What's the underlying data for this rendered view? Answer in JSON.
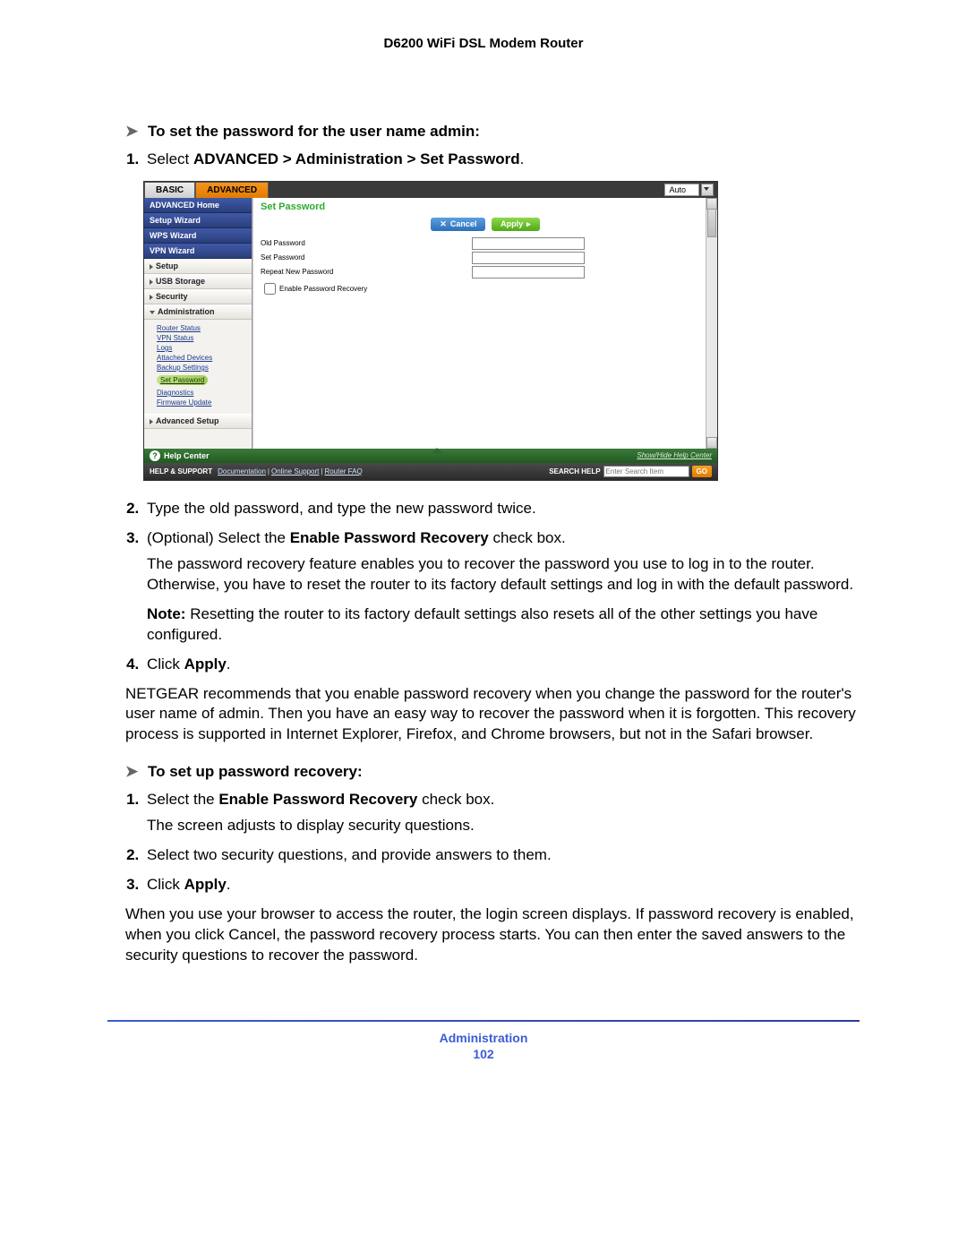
{
  "header": {
    "title": "D6200 WiFi DSL Modem Router"
  },
  "task1": {
    "heading": "To set the password for the user name admin:",
    "steps": {
      "s1_pre": "Select ",
      "s1_bold": "ADVANCED > Administration > Set Password",
      "s1_post": ".",
      "s2": "Type the old password, and type the new password twice.",
      "s3_pre": "(Optional) Select the ",
      "s3_bold": "Enable Password Recovery",
      "s3_post": " check box.",
      "s3_body": "The password recovery feature enables you to recover the password you use to log in to the router. Otherwise, you have to reset the router to its factory default settings and log in with the default password.",
      "note_label": "Note:",
      "note_text": "Resetting the router to its factory default settings also resets all of the other settings you have configured.",
      "s4_pre": "Click ",
      "s4_bold": "Apply",
      "s4_post": "."
    },
    "after": "NETGEAR recommends that you enable password recovery when you change the password for the router's user name of admin. Then you have an easy way to recover the password when it is forgotten. This recovery process is supported in Internet Explorer, Firefox, and Chrome browsers, but not in the Safari browser."
  },
  "task2": {
    "heading": "To set up password recovery:",
    "steps": {
      "s1_pre": "Select the ",
      "s1_bold": "Enable Password Recovery",
      "s1_post": " check box.",
      "s1_body": "The screen adjusts to display security questions.",
      "s2": "Select two security questions, and provide answers to them.",
      "s3_pre": "Click ",
      "s3_bold": "Apply",
      "s3_post": "."
    },
    "after": "When you use your browser to access the router, the login screen displays. If password recovery is enabled, when you click Cancel, the password recovery process starts. You can then enter the saved answers to the security questions to recover the password."
  },
  "router": {
    "tabs": {
      "basic": "BASIC",
      "advanced": "ADVANCED",
      "auto": "Auto"
    },
    "sidebar": {
      "home": "ADVANCED Home",
      "setup_wizard": "Setup Wizard",
      "wps_wizard": "WPS Wizard",
      "vpn_wizard": "VPN Wizard",
      "setup": "Setup",
      "usb": "USB Storage",
      "security": "Security",
      "administration": "Administration",
      "admin_items": {
        "router_status": "Router Status",
        "vpn_status": "VPN Status",
        "logs": "Logs",
        "attached": "Attached Devices",
        "backup": "Backup Settings",
        "set_password": "Set Password",
        "diagnostics": "Diagnostics",
        "firmware": "Firmware Update"
      },
      "adv_setup": "Advanced Setup"
    },
    "content": {
      "title": "Set Password",
      "cancel": "Cancel",
      "apply": "Apply",
      "old_pw": "Old Password",
      "set_pw": "Set Password",
      "repeat_pw": "Repeat New Password",
      "enable_recovery": "Enable Password Recovery"
    },
    "help": {
      "title": "Help Center",
      "toggle": "Show/Hide Help Center"
    },
    "footer": {
      "hs": "HELP & SUPPORT",
      "doc": "Documentation",
      "support": "Online Support",
      "faq": "Router FAQ",
      "search_label": "SEARCH HELP",
      "placeholder": "Enter Search Item",
      "go": "GO"
    }
  },
  "page_footer": {
    "section": "Administration",
    "page": "102"
  }
}
